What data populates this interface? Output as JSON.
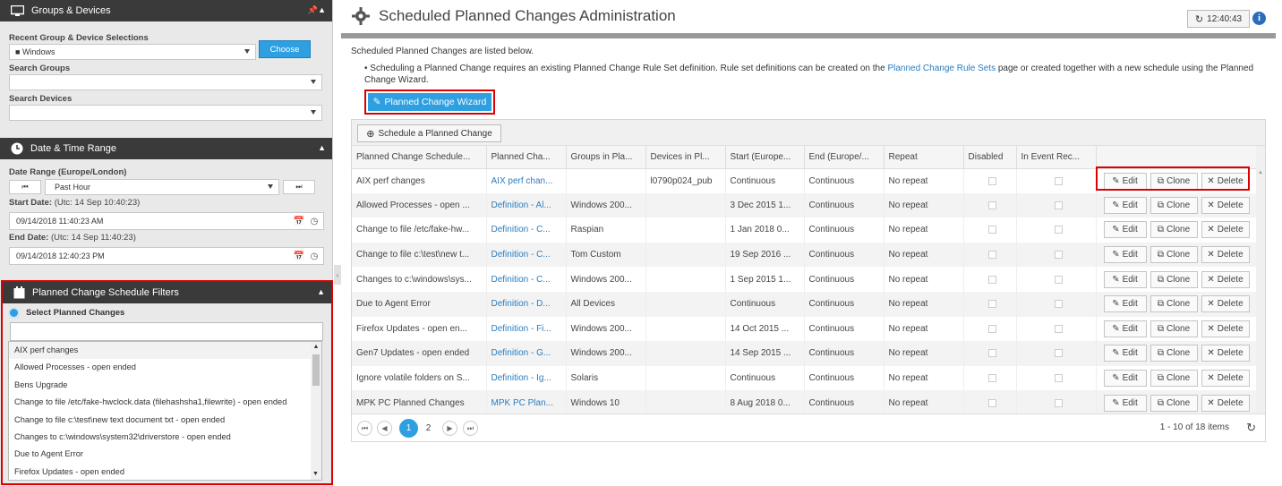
{
  "groups_panel": {
    "title": "Groups & Devices",
    "recent_label": "Recent Group & Device Selections",
    "recent_value": "Windows",
    "choose_label": "Choose",
    "search_groups_label": "Search Groups",
    "search_devices_label": "Search Devices"
  },
  "date_panel": {
    "title": "Date & Time Range",
    "range_label": "Date Range (Europe/London)",
    "range_value": "Past Hour",
    "start_label": "Start Date:",
    "start_utc": "(Utc: 14 Sep 10:40:23)",
    "start_value": "09/14/2018 11:40:23 AM",
    "end_label": "End Date:",
    "end_utc": "(Utc: 14 Sep 11:40:23)",
    "end_value": "09/14/2018 12:40:23 PM"
  },
  "filter_panel": {
    "title": "Planned Change Schedule Filters",
    "radio_label": "Select Planned Changes",
    "items": [
      "AIX perf changes",
      "Allowed Processes - open ended",
      "Bens Upgrade",
      "Change to file /etc/fake-hwclock.data (filehashsha1,filewrite) - open ended",
      "Change to file c:\\test\\new text document txt - open ended",
      "Changes to c:\\windows\\system32\\driverstore - open ended",
      "Due to Agent Error",
      "Firefox Updates - open ended"
    ]
  },
  "header": {
    "title": "Scheduled Planned Changes Administration",
    "time": "12:40:43",
    "info": "i"
  },
  "intro": {
    "text": "Scheduled Planned Changes are listed below.",
    "bullet_a": "Scheduling a Planned Change requires an existing Planned Change Rule Set definition. Rule set definitions can be created on the ",
    "bullet_link": "Planned Change Rule Sets",
    "bullet_b": " page or created together with a new schedule using the Planned Change Wizard."
  },
  "wizard_label": "Planned Change Wizard",
  "schedule_button": "Schedule a Planned Change",
  "columns": [
    "Planned Change Schedule...",
    "Planned Cha...",
    "Groups in Pla...",
    "Devices in Pl...",
    "Start (Europe...",
    "End (Europe/...",
    "Repeat",
    "Disabled",
    "In Event Rec..."
  ],
  "actions": {
    "edit": "Edit",
    "clone": "Clone",
    "delete": "Delete"
  },
  "rows": [
    [
      "AIX perf changes",
      "AIX perf chan...",
      "",
      "l0790p024_pub",
      "Continuous",
      "Continuous",
      "No repeat"
    ],
    [
      "Allowed Processes - open ...",
      "Definition - Al...",
      "Windows 200...",
      "",
      "3 Dec 2015 1...",
      "Continuous",
      "No repeat"
    ],
    [
      "Change to file /etc/fake-hw...",
      "Definition - C...",
      "Raspian",
      "",
      "1 Jan 2018 0...",
      "Continuous",
      "No repeat"
    ],
    [
      "Change to file c:\\test\\new t...",
      "Definition - C...",
      "Tom Custom",
      "",
      "19 Sep 2016 ...",
      "Continuous",
      "No repeat"
    ],
    [
      "Changes to c:\\windows\\sys...",
      "Definition - C...",
      "Windows 200...",
      "",
      "1 Sep 2015 1...",
      "Continuous",
      "No repeat"
    ],
    [
      "Due to Agent Error",
      "Definition - D...",
      "All Devices",
      "",
      "Continuous",
      "Continuous",
      "No repeat"
    ],
    [
      "Firefox Updates - open en...",
      "Definition - Fi...",
      "Windows 200...",
      "",
      "14 Oct 2015 ...",
      "Continuous",
      "No repeat"
    ],
    [
      "Gen7 Updates - open ended",
      "Definition - G...",
      "Windows 200...",
      "",
      "14 Sep 2015 ...",
      "Continuous",
      "No repeat"
    ],
    [
      "Ignore volatile folders on S...",
      "Definition - Ig...",
      "Solaris",
      "",
      "Continuous",
      "Continuous",
      "No repeat"
    ],
    [
      "MPK PC Planned Changes",
      "MPK PC Plan...",
      "Windows 10",
      "",
      "8 Aug 2018 0...",
      "Continuous",
      "No repeat"
    ]
  ],
  "pager": {
    "pages": [
      "1",
      "2"
    ],
    "summary": "1 - 10 of 18 items"
  }
}
